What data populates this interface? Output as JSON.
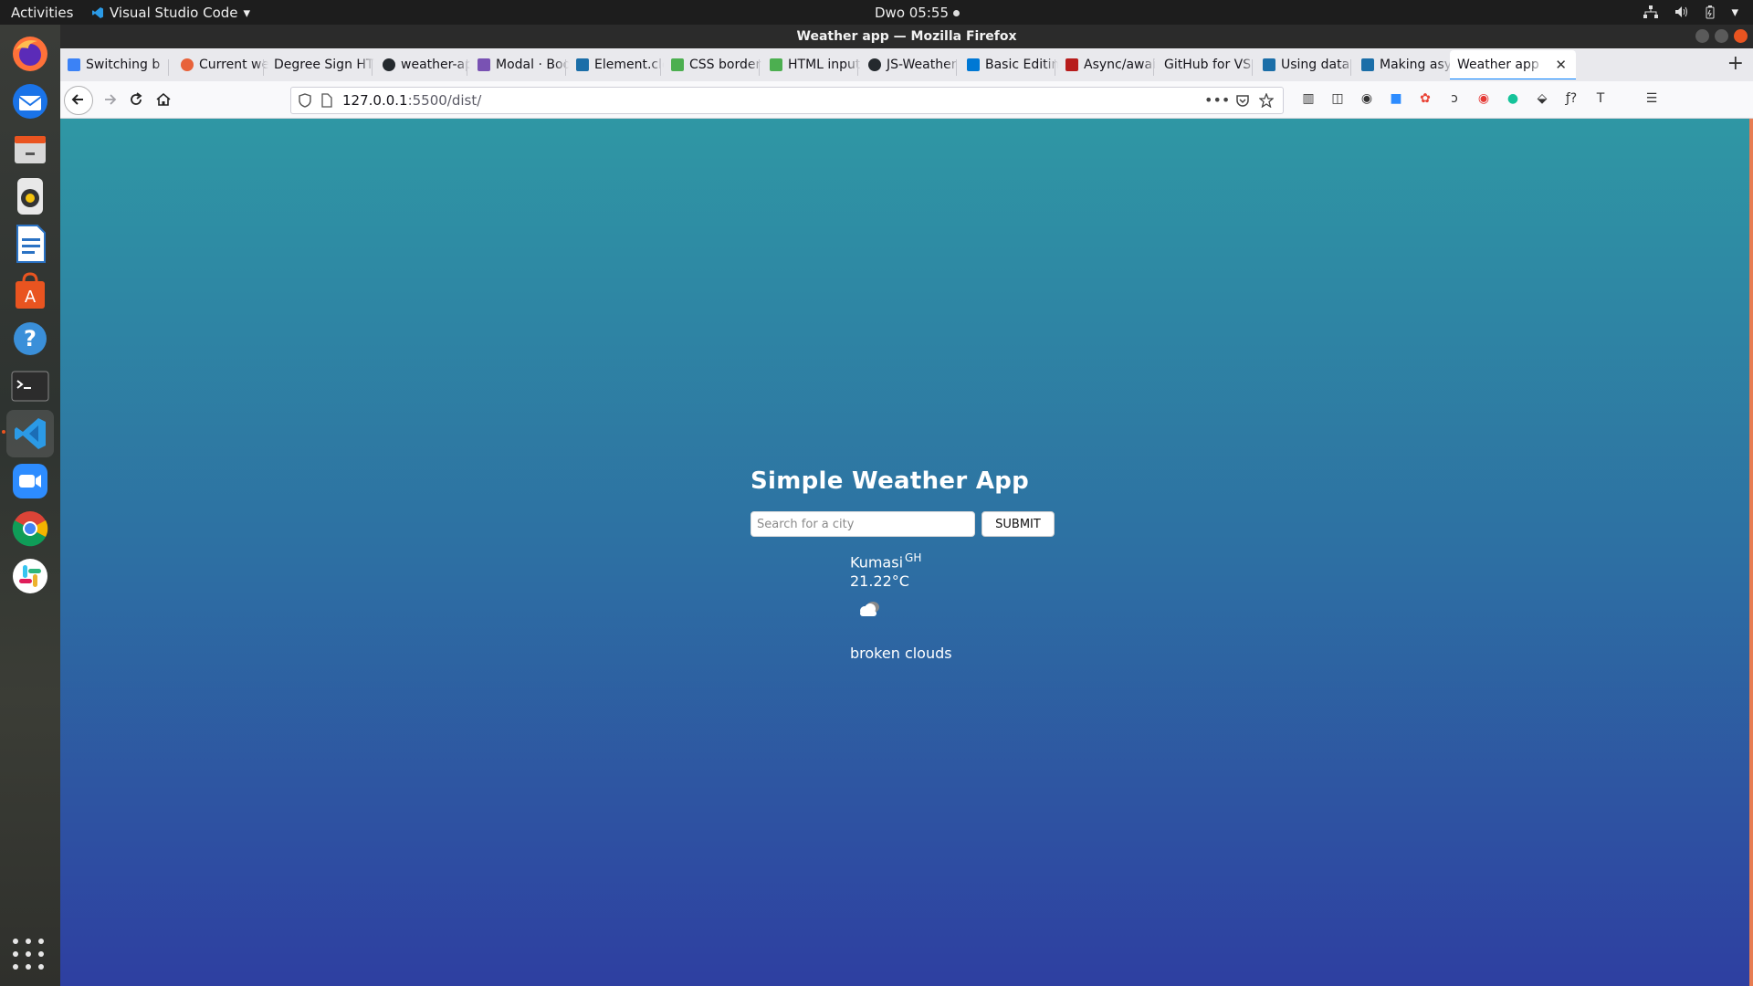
{
  "system_bar": {
    "activities": "Activities",
    "app_name": "Visual Studio Code",
    "clock": "Dwo 05:55"
  },
  "dock": {
    "items": [
      "firefox-icon",
      "thunderbird-icon",
      "files-icon",
      "rhythmbox-icon",
      "libreoffice-writer-icon",
      "software-center-icon",
      "help-icon",
      "terminal-icon",
      "vscode-icon",
      "zoom-icon",
      "chrome-icon",
      "slack-icon"
    ]
  },
  "window": {
    "title": "Weather app — Mozilla Firefox"
  },
  "tabs": [
    {
      "label": "Switching b",
      "favicon_color": "#3b82f6"
    },
    {
      "label": "Current we",
      "favicon_color": "#e8623a"
    },
    {
      "label": "Degree Sign HT",
      "favicon_color": ""
    },
    {
      "label": "weather-ap",
      "favicon_color": "#24292e"
    },
    {
      "label": "Modal · Boo",
      "favicon_color": "#7952b3"
    },
    {
      "label": "Element.clo",
      "favicon_color": "#1b6ea8"
    },
    {
      "label": "CSS border",
      "favicon_color": "#4caf50"
    },
    {
      "label": "HTML input",
      "favicon_color": "#4caf50"
    },
    {
      "label": "JS-Weather",
      "favicon_color": "#24292e"
    },
    {
      "label": "Basic Editin",
      "favicon_color": "#0078d4"
    },
    {
      "label": "Async/awai",
      "favicon_color": "#b71c1c"
    },
    {
      "label": "GitHub for VS C",
      "favicon_color": ""
    },
    {
      "label": "Using data",
      "favicon_color": "#1b6ea8"
    },
    {
      "label": "Making asy",
      "favicon_color": "#1b6ea8"
    },
    {
      "label": "Weather app",
      "favicon_color": "",
      "active": true
    }
  ],
  "address_bar": {
    "host": "127.0.0.1",
    "rest": ":5500/dist/"
  },
  "page": {
    "title": "Simple Weather App",
    "search_placeholder": "Search for a city",
    "submit_label": "SUBMIT",
    "city": "Kumasi",
    "country": "GH",
    "temperature": "21.22°C",
    "weather_icon": "broken-clouds-icon",
    "description": "broken clouds"
  },
  "colors": {
    "gradient_top": "#2f97a4",
    "gradient_bottom": "#2e3fa1",
    "ubuntu_orange": "#e95420"
  }
}
